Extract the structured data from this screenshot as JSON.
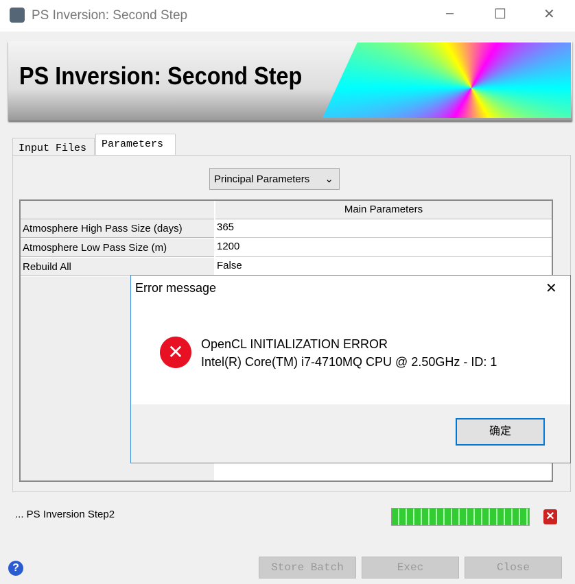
{
  "window": {
    "title": "PS Inversion: Second Step",
    "minimize": "–",
    "maximize": "☐",
    "close": "✕"
  },
  "banner": {
    "title": "PS Inversion: Second Step"
  },
  "tabs": [
    {
      "label": "Input Files",
      "active": false
    },
    {
      "label": "Parameters",
      "active": true
    }
  ],
  "dropdown": {
    "value": "Principal Parameters",
    "icon": "chevron-down-icon"
  },
  "table": {
    "header": "Main Parameters",
    "rows": [
      {
        "label": "Atmosphere High Pass Size (days)",
        "value": "365"
      },
      {
        "label": "Atmosphere Low Pass Size (m)",
        "value": "1200"
      },
      {
        "label": "Rebuild All",
        "value": "False"
      }
    ]
  },
  "status": {
    "text": "... PS Inversion Step2",
    "progress_percent": 100
  },
  "buttons": {
    "store_batch": "Store Batch",
    "exec": "Exec",
    "close": "Close"
  },
  "dialog": {
    "title": "Error message",
    "line1": "OpenCL INITIALIZATION ERROR",
    "line2": "Intel(R) Core(TM) i7-4710MQ CPU @ 2.50GHz - ID: 1",
    "ok": "确定",
    "close": "✕"
  },
  "colors": {
    "error": "#e81123",
    "accent": "#0078d7",
    "progress": "#33cc33"
  }
}
